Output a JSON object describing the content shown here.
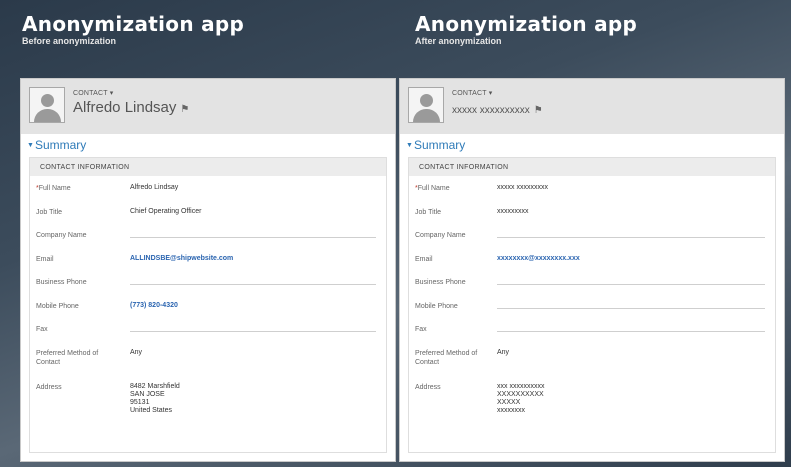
{
  "panels": [
    {
      "app_title": "Anonymization app",
      "subtitle": "Before anonymization",
      "entity_label": "CONTACT",
      "contact_name": "Alfredo Lindsay",
      "summary": "Summary",
      "section_title": "CONTACT INFORMATION",
      "fields": {
        "full_name": {
          "label": "Full Name",
          "value": "Alfredo Lindsay"
        },
        "job_title": {
          "label": "Job Title",
          "value": "Chief Operating Officer"
        },
        "company": {
          "label": "Company Name",
          "value": ""
        },
        "email": {
          "label": "Email",
          "value": "ALLINDSBE@shipwebsite.com"
        },
        "business_phone": {
          "label": "Business Phone",
          "value": ""
        },
        "mobile_phone": {
          "label": "Mobile Phone",
          "value": "(773) 820-4320"
        },
        "fax": {
          "label": "Fax",
          "value": ""
        },
        "preferred_contact": {
          "label": "Preferred Method of Contact",
          "value": "Any"
        },
        "address": {
          "label": "Address",
          "lines": [
            "8482 Marshfield",
            "SAN JOSE",
            "95131",
            "United States"
          ]
        }
      }
    },
    {
      "app_title": "Anonymization app",
      "subtitle": "After anonymization",
      "entity_label": "CONTACT",
      "contact_name": "xxxxx xxxxxxxxxx",
      "summary": "Summary",
      "section_title": "CONTACT INFORMATION",
      "fields": {
        "full_name": {
          "label": "Full Name",
          "value": "xxxxx xxxxxxxxx"
        },
        "job_title": {
          "label": "Job Title",
          "value": "xxxxxxxxx"
        },
        "company": {
          "label": "Company Name",
          "value": ""
        },
        "email": {
          "label": "Email",
          "value": "xxxxxxxx@xxxxxxxx.xxx"
        },
        "business_phone": {
          "label": "Business Phone",
          "value": ""
        },
        "mobile_phone": {
          "label": "Mobile Phone",
          "value": ""
        },
        "fax": {
          "label": "Fax",
          "value": ""
        },
        "preferred_contact": {
          "label": "Preferred Method of Contact",
          "value": "Any"
        },
        "address": {
          "label": "Address",
          "lines": [
            "xxx xxxxxxxxxx",
            "XXXXXXXXXX",
            "XXXXX",
            "xxxxxxxx"
          ]
        }
      }
    }
  ],
  "colors": {
    "accent": "#2f7bb8",
    "link": "#2a64b0",
    "header_bg": "#e3e3e3"
  }
}
